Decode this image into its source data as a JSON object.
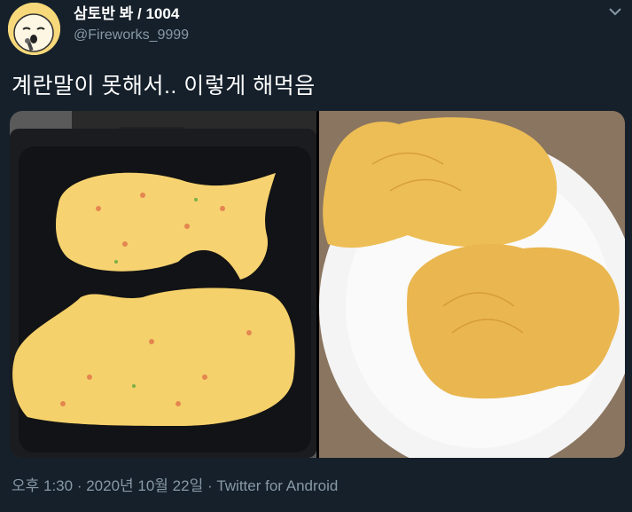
{
  "tweet": {
    "display_name": "삼토반 봐 / 1004",
    "handle": "@Fireworks_9999",
    "text": "계란말이 못해서.. 이렇게 해먹음",
    "time": "오후 1:30",
    "separator": " · ",
    "date": "2020년 10월 22일",
    "source": "Twitter for Android"
  },
  "icons": {
    "avatar": "cartoon-singer-avatar",
    "menu": "chevron-down-icon"
  },
  "colors": {
    "background": "#15202b",
    "secondary_text": "#8899a6",
    "egg": "#f3c235"
  }
}
